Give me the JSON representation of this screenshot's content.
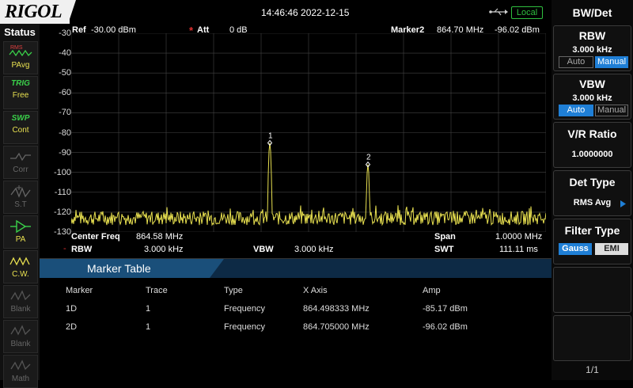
{
  "brand": {
    "logo": "RIGOL"
  },
  "topbar": {
    "datetime": "14:46:46 2022-12-15",
    "remote_label": "Local"
  },
  "status": {
    "title": "Status",
    "items": [
      {
        "top": "RMS",
        "label": "PAvg",
        "icon": "average-waveform-icon",
        "state": "active"
      },
      {
        "top": "TRIG",
        "label": "Free",
        "icon": "",
        "state": "active"
      },
      {
        "top": "SWP",
        "label": "Cont",
        "icon": "",
        "state": "active"
      },
      {
        "top": "",
        "label": "Corr",
        "icon": "correction-icon",
        "state": "inactive"
      },
      {
        "top": "",
        "label": "S.T",
        "icon": "signal-tracking-icon",
        "state": "inactive"
      },
      {
        "top": "",
        "label": "PA",
        "icon": "preamp-icon",
        "state": "green"
      },
      {
        "top": "",
        "label": "C.W.",
        "icon": "continuous-wave-icon",
        "state": "active"
      },
      {
        "top": "",
        "label": "Blank",
        "icon": "blank-trace-icon",
        "state": "inactive"
      },
      {
        "top": "",
        "label": "Blank",
        "icon": "blank-trace-icon",
        "state": "inactive"
      },
      {
        "top": "",
        "label": "Math",
        "icon": "math-trace-icon",
        "state": "inactive"
      }
    ]
  },
  "plot": {
    "ref_label": "Ref",
    "ref_value": "-30.00 dBm",
    "att_label": "Att",
    "att_value": "0 dB",
    "marker_label": "Marker2",
    "marker_freq": "864.70 MHz",
    "marker_amp": "-96.02 dBm",
    "y_labels": [
      "-30",
      "-40",
      "-50",
      "-60",
      "-70",
      "-80",
      "-90",
      "-100",
      "-110",
      "-120",
      "-130"
    ],
    "center_freq_label": "Center Freq",
    "center_freq_value": "864.58 MHz",
    "span_label": "Span",
    "span_value": "1.0000 MHz",
    "rbw_label": "RBW",
    "rbw_value": "3.000 kHz",
    "vbw_label": "VBW",
    "vbw_value": "3.000 kHz",
    "swt_label": "SWT",
    "swt_value": "111.11 ms",
    "marker1_label": "1",
    "marker2_label": "2"
  },
  "chart_data": {
    "type": "line",
    "x_unit": "MHz",
    "y_unit": "dBm",
    "xlim": [
      864.08,
      865.08
    ],
    "ylim": [
      -130,
      -30
    ],
    "grid": true,
    "noise_floor": -123,
    "peaks": [
      {
        "x": 864.498333,
        "y": -85.17
      },
      {
        "x": 864.705,
        "y": -96.02
      }
    ],
    "color": "#e8e050"
  },
  "marker_table": {
    "title": "Marker Table",
    "headers": [
      "Marker",
      "Trace",
      "Type",
      "X Axis",
      "Amp"
    ],
    "rows": [
      [
        "1D",
        "1",
        "Frequency",
        "864.498333 MHz",
        "-85.17 dBm"
      ],
      [
        "2D",
        "1",
        "Frequency",
        "864.705000 MHz",
        "-96.02 dBm"
      ]
    ]
  },
  "menu": {
    "title": "BW/Det",
    "rbw": {
      "title": "RBW",
      "value": "3.000 kHz",
      "opt_auto": "Auto",
      "opt_manual": "Manual"
    },
    "vbw": {
      "title": "VBW",
      "value": "3.000 kHz",
      "opt_auto": "Auto",
      "opt_manual": "Manual"
    },
    "vr": {
      "title": "V/R Ratio",
      "value": "1.0000000"
    },
    "det": {
      "title": "Det Type",
      "value": "RMS Avg"
    },
    "filter": {
      "title": "Filter Type",
      "opt_gauss": "Gauss",
      "opt_emi": "EMI"
    },
    "page": "1/1"
  },
  "colors": {
    "trace": "#e8e050",
    "accent": "#1f7fd6",
    "grid": "#444444"
  }
}
